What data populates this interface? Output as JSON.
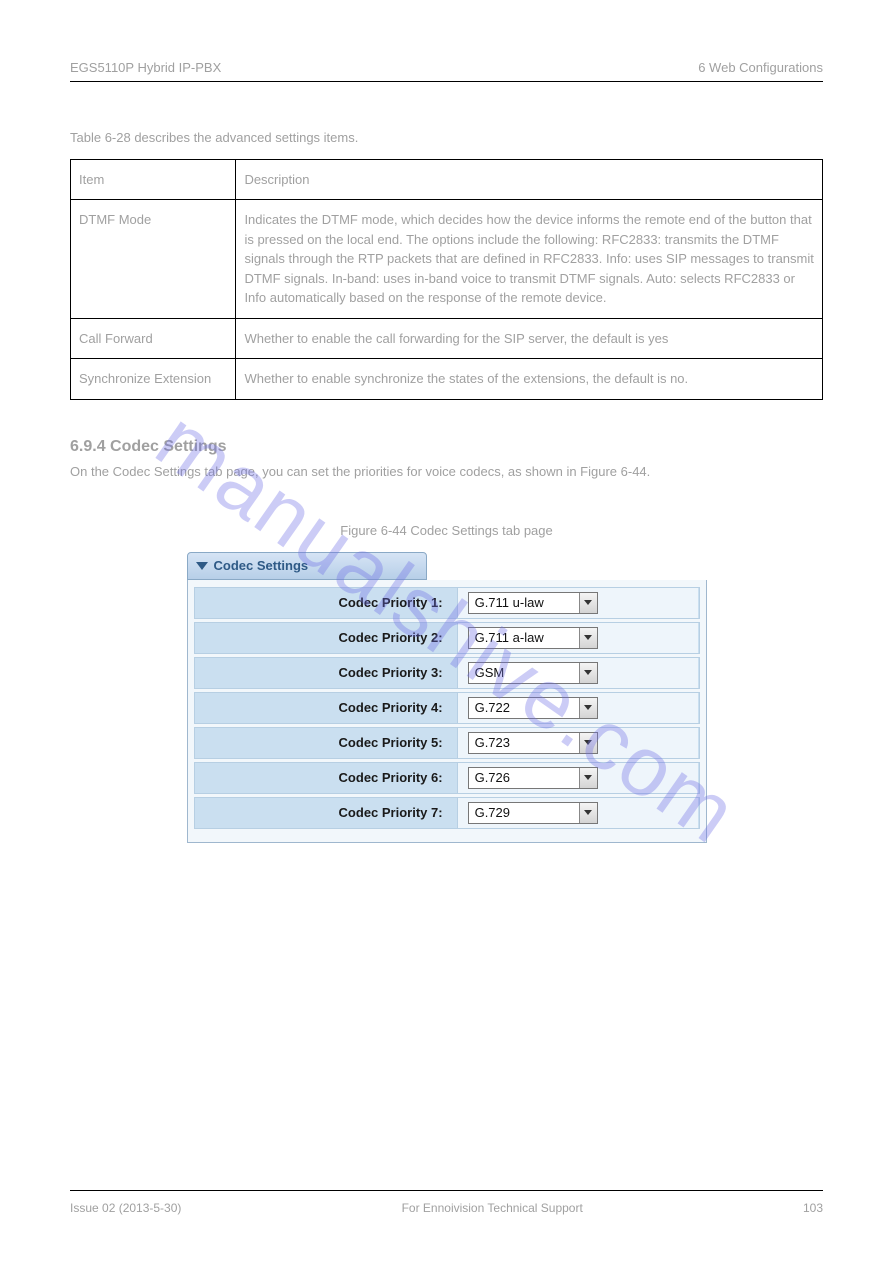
{
  "header": {
    "product": "EGS5110P Hybrid IP-PBX",
    "chapter": "6 Web Configurations"
  },
  "body": {
    "intro": "Table 6-28 describes the advanced settings items."
  },
  "table": {
    "header": {
      "item": "Item",
      "desc": "Description"
    },
    "rows": [
      {
        "item": "DTMF Mode",
        "desc": "Indicates the DTMF mode, which decides how the device informs the remote end of the button that is pressed on the local end. The options include the following: RFC2833: transmits the DTMF signals through the RTP packets that are defined in RFC2833. Info: uses SIP messages to transmit DTMF signals. In-band: uses in-band voice to transmit DTMF signals. Auto: selects RFC2833 or Info automatically based on the response of the remote device."
      },
      {
        "item": "Call Forward",
        "desc": "Whether to enable the call forwarding for the SIP server, the default is yes"
      },
      {
        "item": "Synchronize Extension",
        "desc": "Whether to enable synchronize the states of the extensions, the default is no."
      }
    ]
  },
  "section": {
    "heading": "6.9.4 Codec Settings",
    "text": "On the Codec Settings tab page, you can set the priorities for voice codecs, as shown in Figure 6-44."
  },
  "figure": {
    "caption": "Figure 6-44 Codec Settings tab page"
  },
  "codec": {
    "title": "Codec Settings",
    "rows": [
      {
        "label": "Codec Priority 1:",
        "value": "G.711 u-law"
      },
      {
        "label": "Codec Priority 2:",
        "value": "G.711 a-law"
      },
      {
        "label": "Codec Priority 3:",
        "value": "GSM"
      },
      {
        "label": "Codec Priority 4:",
        "value": "G.722"
      },
      {
        "label": "Codec Priority 5:",
        "value": "G.723"
      },
      {
        "label": "Codec Priority 6:",
        "value": "G.726"
      },
      {
        "label": "Codec Priority 7:",
        "value": "G.729"
      }
    ]
  },
  "watermark": "manualshive.com",
  "footer": {
    "issue": "Issue 02 (2013-5-30)",
    "copyright": "For Ennoivision Technical Support",
    "page": "103"
  }
}
